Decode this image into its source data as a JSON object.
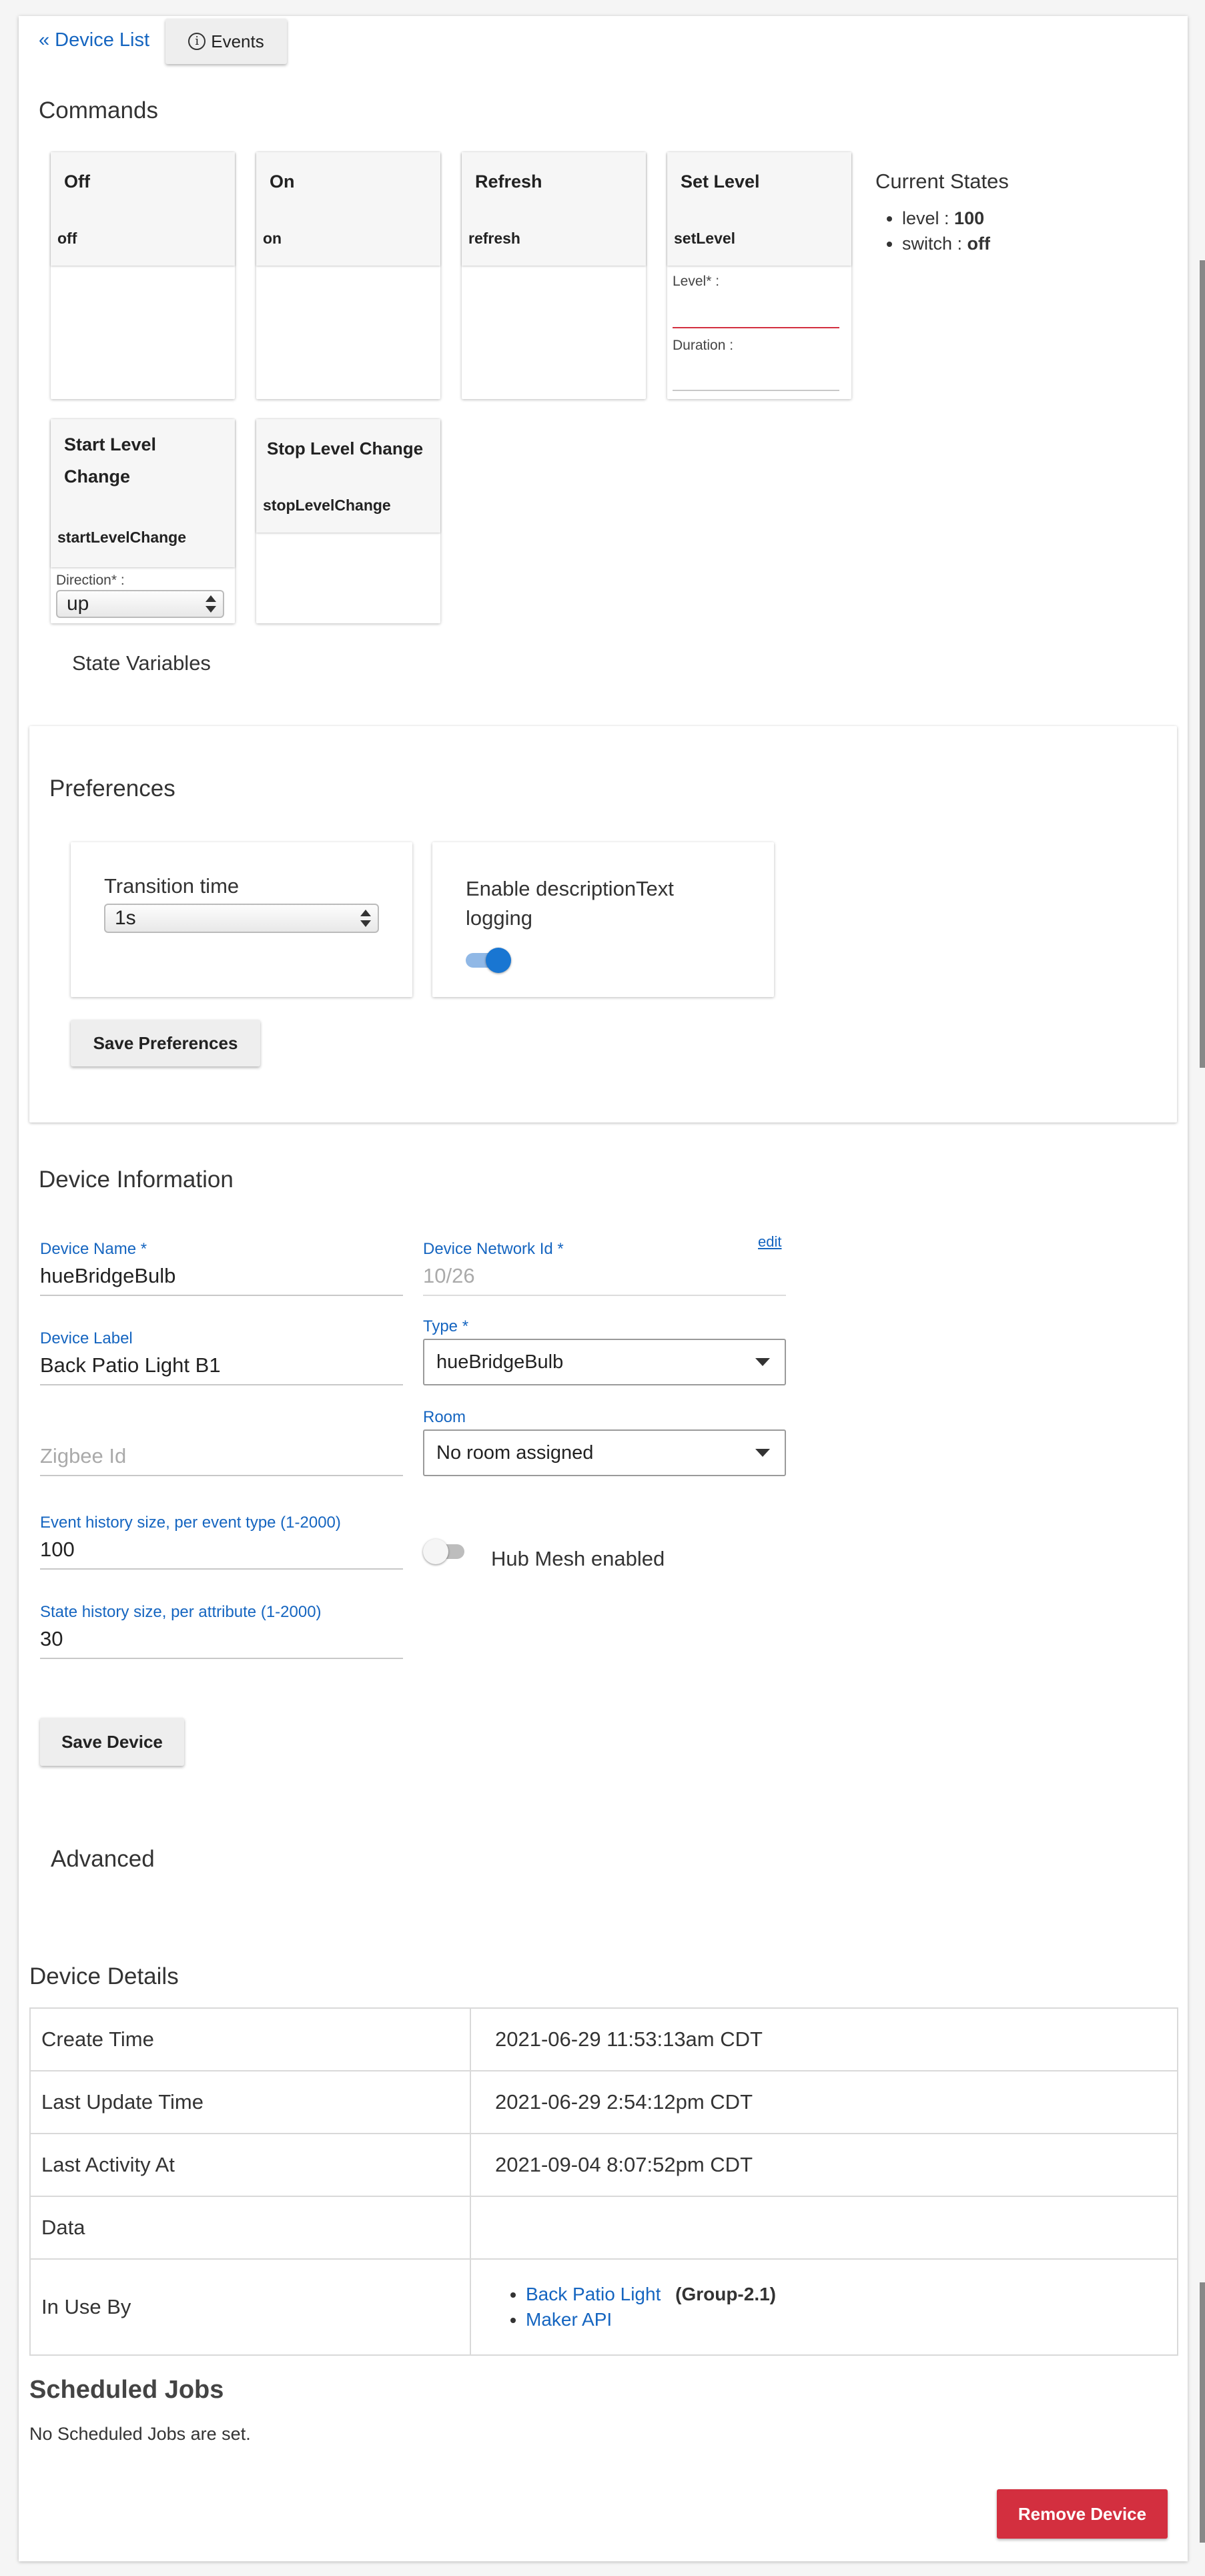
{
  "nav": {
    "device_list": "« Device List",
    "events": "Events"
  },
  "commands": {
    "heading": "Commands",
    "items": [
      {
        "title": "Off",
        "name": "off"
      },
      {
        "title": "On",
        "name": "on"
      },
      {
        "title": "Refresh",
        "name": "refresh"
      },
      {
        "title": "Set Level",
        "name": "setLevel",
        "params": [
          "Level* :",
          "Duration :"
        ]
      },
      {
        "title_line1": "Start Level",
        "title_line2": "Change",
        "name": "startLevelChange",
        "param": "Direction* :",
        "select_value": "up"
      },
      {
        "title": "Stop Level Change",
        "name": "stopLevelChange"
      }
    ]
  },
  "current_states": {
    "heading": "Current States",
    "items": [
      {
        "key": "level : ",
        "value": "100"
      },
      {
        "key": "switch : ",
        "value": "off"
      }
    ]
  },
  "state_variables": "State Variables",
  "preferences": {
    "heading": "Preferences",
    "transition_label": "Transition time",
    "transition_value": "1s",
    "logging_label_1": "Enable descriptionText",
    "logging_label_2": "logging",
    "logging_on": true,
    "save_label": "Save Preferences"
  },
  "device_info": {
    "heading": "Device Information",
    "name_label": "Device Name *",
    "name_value": "hueBridgeBulb",
    "network_label": "Device Network Id *",
    "network_value": "10/26",
    "edit": "edit",
    "label_label": "Device Label",
    "label_value": "Back Patio Light B1",
    "type_label": "Type *",
    "type_value": "hueBridgeBulb",
    "room_label": "Room",
    "room_value": "No room assigned",
    "zigbee_placeholder": "Zigbee Id",
    "event_history_label": "Event history size, per event type (1-2000)",
    "event_history_value": "100",
    "hub_mesh_label": "Hub Mesh enabled",
    "hub_mesh_on": false,
    "state_history_label": "State history size, per attribute (1-2000)",
    "state_history_value": "30",
    "save_label": "Save Device"
  },
  "advanced": "Advanced",
  "device_details": {
    "heading": "Device Details",
    "rows": [
      {
        "key": "Create Time",
        "value": "2021-06-29 11:53:13am CDT"
      },
      {
        "key": "Last Update Time",
        "value": "2021-06-29 2:54:12pm CDT"
      },
      {
        "key": "Last Activity At",
        "value": "2021-09-04 8:07:52pm CDT"
      },
      {
        "key": "Data",
        "value": ""
      },
      {
        "key": "In Use By",
        "value": ""
      }
    ],
    "in_use_by": [
      {
        "name": "Back Patio Light",
        "note": "(Group-2.1)"
      },
      {
        "name": "Maker API",
        "note": ""
      }
    ]
  },
  "scheduled_jobs": {
    "heading": "Scheduled Jobs",
    "text": "No Scheduled Jobs are set."
  },
  "remove_label": "Remove Device",
  "colors": {
    "link": "#1565c0",
    "danger": "#d32f3f",
    "toggle": "#1976d2"
  }
}
